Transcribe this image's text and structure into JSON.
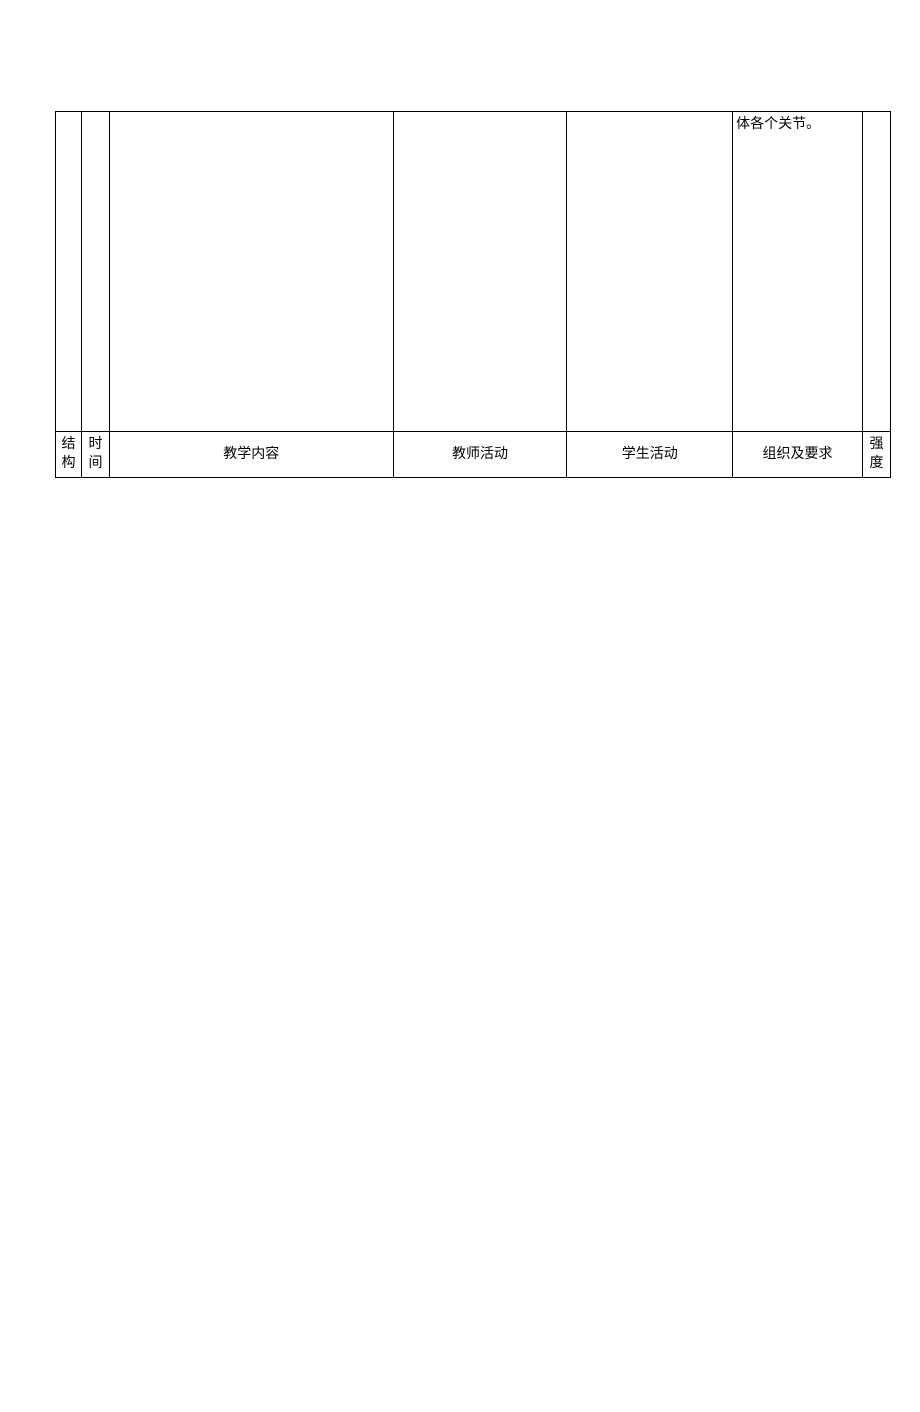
{
  "rows": {
    "top": {
      "col1": "",
      "col2": "",
      "col3": "",
      "col4": "",
      "col5": "",
      "col6": "体各个关节。",
      "col7": ""
    },
    "header": {
      "col1": "结构",
      "col2": "时间",
      "col3": "教学内容",
      "col4": "教师活动",
      "col5": "学生活动",
      "col6": "组织及要求",
      "col7": "强度"
    }
  }
}
